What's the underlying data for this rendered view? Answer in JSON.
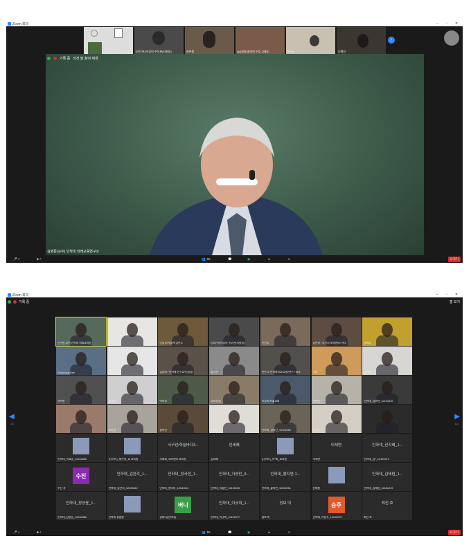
{
  "app": {
    "title": "Zoom 회의"
  },
  "window1": {
    "strip": [
      {
        "name": ""
      },
      {
        "name": "(미디어)/이상미 주무관(지원청)"
      },
      {
        "name": "진주원"
      },
      {
        "name": "(남)창원/송미진 수업 고흥도"
      },
      {
        "name": "박*경"
      },
      {
        "name": "나행진"
      }
    ],
    "recording": "기록 중",
    "recording_sub": "의견 말 참여 재개",
    "speaker_name": "김영준(교수) 인하대 외래교육연구소",
    "controls": {
      "participants": "55",
      "leave": "나가기"
    }
  },
  "window2": {
    "recording": "기록 중",
    "view": "갤 보기",
    "page_left": "1/2",
    "page_right": "1/2",
    "tiles": [
      {
        "name": "진주원 교수(인하대 외래교육원",
        "bg": "#566a5c",
        "hl": true
      },
      {
        "name": "",
        "bg": "#e8e6e2"
      },
      {
        "name": "안임장/이렇게 장찬도",
        "bg": "#6e5a3a"
      },
      {
        "name": "(미디어)/이상미 주무관(지원청)",
        "bg": "#4a4a4a"
      },
      {
        "name": "우진임",
        "bg": "#7a6a5a"
      },
      {
        "name": "김현희 / 오산시 보육센터/ 이다",
        "bg": "#5c4c42"
      },
      {
        "name": "정희정",
        "bg": "#c2a030"
      },
      {
        "name": "Sunyoung Bae",
        "bg": "#5a6e86"
      },
      {
        "name": "mypro",
        "bg": "#e6e6e6"
      },
      {
        "name": "김남희 / 인하대 연구교수(공동)",
        "bg": "#5a5248"
      },
      {
        "name": "강나진",
        "bg": "#8a8a8a"
      },
      {
        "name": "인천 4/ 인하대학교/교원/연구 / 교사",
        "bg": "#52504c"
      },
      {
        "name": "이화",
        "bg": "#d09a5a"
      },
      {
        "name": "김나리",
        "bg": "#d8d6d2"
      },
      {
        "name": "권미현",
        "bg": "#505050"
      },
      {
        "name": "이다정",
        "bg": "#cfcfcf"
      },
      {
        "name": "박하경",
        "bg": "#4e5a48"
      },
      {
        "name": "강지원/임",
        "bg": "#8a7a68"
      },
      {
        "name": "이정미/서울교대",
        "bg": "#4a5a6a"
      },
      {
        "name": "한예빈",
        "bg": "#b6b2aa"
      },
      {
        "name": "인하대_임보현_12101510",
        "bg": "#3a3a3a"
      },
      {
        "name": "",
        "bg": "#9a7a6a"
      },
      {
        "name": "조민경",
        "bg": "#a8a49c"
      },
      {
        "name": "원미진",
        "bg": "#5a4a3a"
      },
      {
        "name": "이지예",
        "bg": "#e0dcd6"
      },
      {
        "name": "인하대_김희진_12101050",
        "bg": "#6a6458"
      },
      {
        "name": "송정윤",
        "bg": "#d4cec4"
      },
      {
        "name": "",
        "label": "세정인",
        "bg": "#2b2b2b"
      },
      {
        "name": "인하대_이교준_12101860",
        "bg": "#2b2b2b",
        "label": ""
      },
      {
        "name": "(나이트)_최은미_교 교육원",
        "bg": "#2b2b2b",
        "label": ""
      },
      {
        "name": "시대회_세로센터 교육원",
        "label": "시구선/하늘바다3...",
        "bg": "#2b2b2b"
      },
      {
        "name": "김지혜",
        "label": "인세혜",
        "bg": "#2b2b2b"
      },
      {
        "name": "(나이트)_이*희_교육원",
        "bg": "#2b2b2b",
        "label": ""
      },
      {
        "name": "이세연",
        "label": "이세연",
        "bg": "#2b2b2b"
      },
      {
        "name": "인하대_김*_12101371",
        "label": "인하대_신지혜_1...",
        "bg": "#2b2b2b"
      },
      {
        "name": "수진 곽",
        "label": "수진",
        "bg": "#2b2b2b"
      },
      {
        "name": "인하대_남은지_12220612",
        "label": "인하대_김완주_1...",
        "bg": "#2b2b2b"
      },
      {
        "name": "인하대_원다비_12181124",
        "label": "인하대_정국현_1...",
        "bg": "#2b2b2b"
      },
      {
        "name": "인하대_지성민_12131003",
        "label": "인하대_지성민_9...",
        "bg": "#2b2b2b"
      },
      {
        "name": "인하대_황지연_12220231",
        "label": "인하대_황지연-1...",
        "bg": "#2b2b2b"
      },
      {
        "name": "윤혜원",
        "bg": "#2b2b2b",
        "label": ""
      },
      {
        "name": "인하대_김태림_12181219",
        "label": "인하대_김태림_1...",
        "bg": "#2b2b2b"
      },
      {
        "name": "인하대_장상윤_12230380",
        "label": "인하대_장상윤_1...",
        "bg": "#2b2b2b"
      },
      {
        "name": "인하대 정중원",
        "bg": "#2b2b2b",
        "label": ""
      },
      {
        "name": "강버니(인하대)",
        "label": "버니",
        "bg": "#2b2b2b"
      },
      {
        "name": "인하대_이규희_12101077",
        "label": "인하대_이규희_1...",
        "bg": "#2b2b2b"
      },
      {
        "name": "정보 미",
        "label": "정보 미",
        "bg": "#2b2b2b"
      },
      {
        "name": "인하대_이승주_12210075",
        "label": "승주",
        "bg": "#2b2b2b"
      },
      {
        "name": "최진 호",
        "label": "최진 호",
        "bg": "#2b2b2b"
      }
    ],
    "controls": {
      "participants": "55",
      "leave": "나가기"
    }
  },
  "colors": {
    "accent": "#2d8cff",
    "leave": "#e02828",
    "highlight": "#d8e020"
  }
}
